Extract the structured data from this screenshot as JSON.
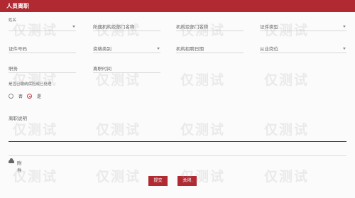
{
  "header": {
    "title": "人员离职"
  },
  "form": {
    "name": {
      "label": "姓名"
    },
    "dept": {
      "placeholder": "所属机构及部门名称"
    },
    "org_dept": {
      "placeholder": "机构及部门名称"
    },
    "cert_type": {
      "placeholder": "证件类型"
    },
    "cert_no": {
      "placeholder": "证件号码"
    },
    "staff_type": {
      "placeholder": "资格类别"
    },
    "hire_date": {
      "placeholder": "机构招聘日期"
    },
    "position": {
      "placeholder": "从业岗位"
    },
    "title": {
      "placeholder": "职务"
    },
    "leave_date": {
      "placeholder": "离职时间"
    },
    "question": {
      "label": "是否已缴纳保险或已处理"
    },
    "radio_no": {
      "label": "否"
    },
    "radio_yes": {
      "label": "是",
      "selected": true
    },
    "description": {
      "label": "离职说明"
    },
    "attachment": {
      "label": "附件",
      "icon": "cloud-upload-icon"
    }
  },
  "actions": {
    "submit_label": "提交",
    "close_label": "关闭"
  },
  "watermark": {
    "text": "仅测试"
  },
  "colors": {
    "accent": "#b12a32"
  }
}
